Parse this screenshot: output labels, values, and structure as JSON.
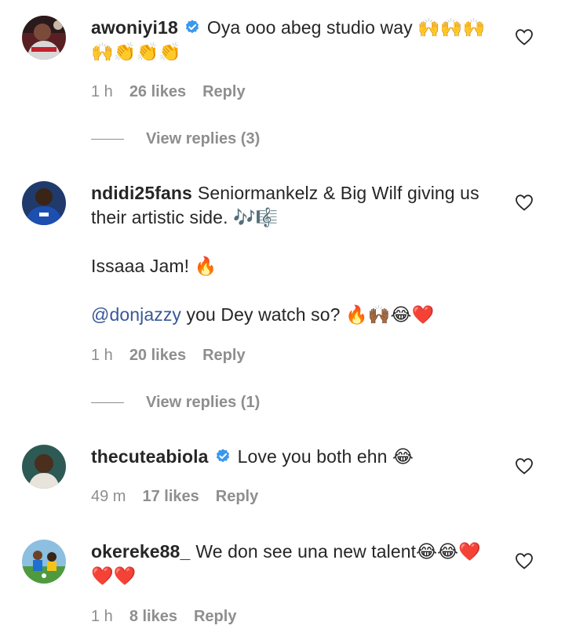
{
  "comments": [
    {
      "username": "awoniyi18",
      "verified": true,
      "text": "Oya ooo abeg studio way 🙌🙌🙌🙌👏👏👏",
      "time": "1 h",
      "likes": "26 likes",
      "reply": "Reply",
      "view_replies": "View replies (3)"
    },
    {
      "username": "ndidi25fans",
      "verified": false,
      "text": "Seniormankelz & Big Wilf giving us their artistic side. 🎶🎼",
      "text2": "Issaaa Jam! 🔥",
      "mention": "@donjazzy",
      "text3": " you Dey watch so? 🔥🙌🏾😂❤️",
      "time": "1 h",
      "likes": "20 likes",
      "reply": "Reply",
      "view_replies": "View replies (1)"
    },
    {
      "username": "thecuteabiola",
      "verified": true,
      "text": "Love you both ehn 😂",
      "time": "49 m",
      "likes": "17 likes",
      "reply": "Reply"
    },
    {
      "username": "okereke88_",
      "verified": false,
      "text": "We don see una new talent😂😂❤️❤️❤️",
      "time": "1 h",
      "likes": "8 likes",
      "reply": "Reply"
    }
  ],
  "colors": {
    "text": "#262626",
    "muted": "#8e8e8e",
    "verified": "#3897f0",
    "mention": "#385898"
  },
  "icons": {
    "like": "heart-outline-icon",
    "verified": "verified-badge-icon"
  }
}
